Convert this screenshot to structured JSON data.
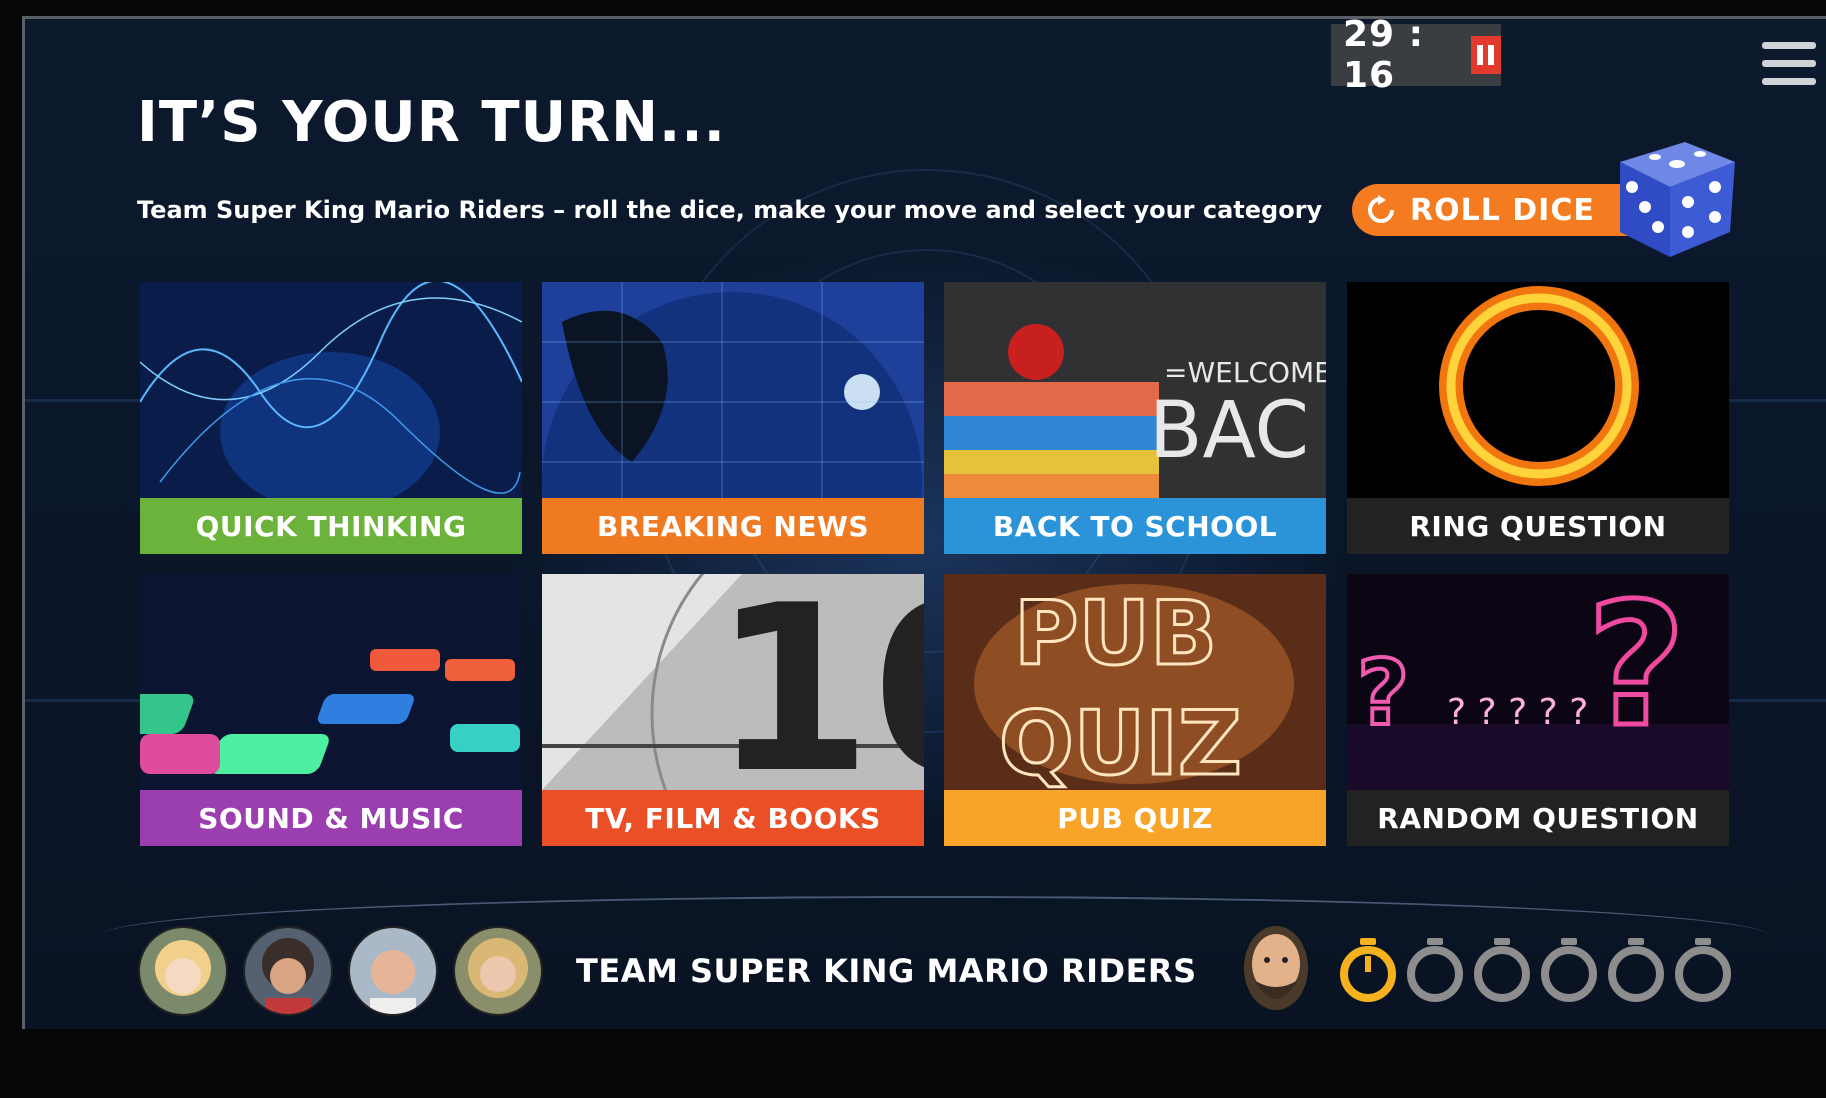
{
  "timer": {
    "value": "29 : 16"
  },
  "header": {
    "title": "IT’S YOUR TURN...",
    "subtitle": "Team Super King Mario Riders – roll the dice, make your move and select your category"
  },
  "roll_button": {
    "label": "ROLL DICE"
  },
  "categories": [
    {
      "label": "QUICK THINKING",
      "color": "#6bb33a"
    },
    {
      "label": "BREAKING NEWS",
      "color": "#f07a22"
    },
    {
      "label": "BACK TO SCHOOL",
      "color": "#2b94d9"
    },
    {
      "label": "RING QUESTION",
      "color": "#222222"
    },
    {
      "label": "SOUND & MUSIC",
      "color": "#9b3fb0"
    },
    {
      "label": "TV, FILM & BOOKS",
      "color": "#ea4f25"
    },
    {
      "label": "PUB QUIZ",
      "color": "#f7a428"
    },
    {
      "label": "RANDOM QUESTION",
      "color": "#222222"
    }
  ],
  "team": {
    "name": "TEAM SUPER KING MARIO RIDERS"
  },
  "stopwatches": {
    "total": 6,
    "active": 1,
    "active_color": "#f5b21e",
    "inactive_color": "#8d8d8d"
  },
  "colors": {
    "accent": "#f47b20",
    "pause": "#e23b2e"
  }
}
